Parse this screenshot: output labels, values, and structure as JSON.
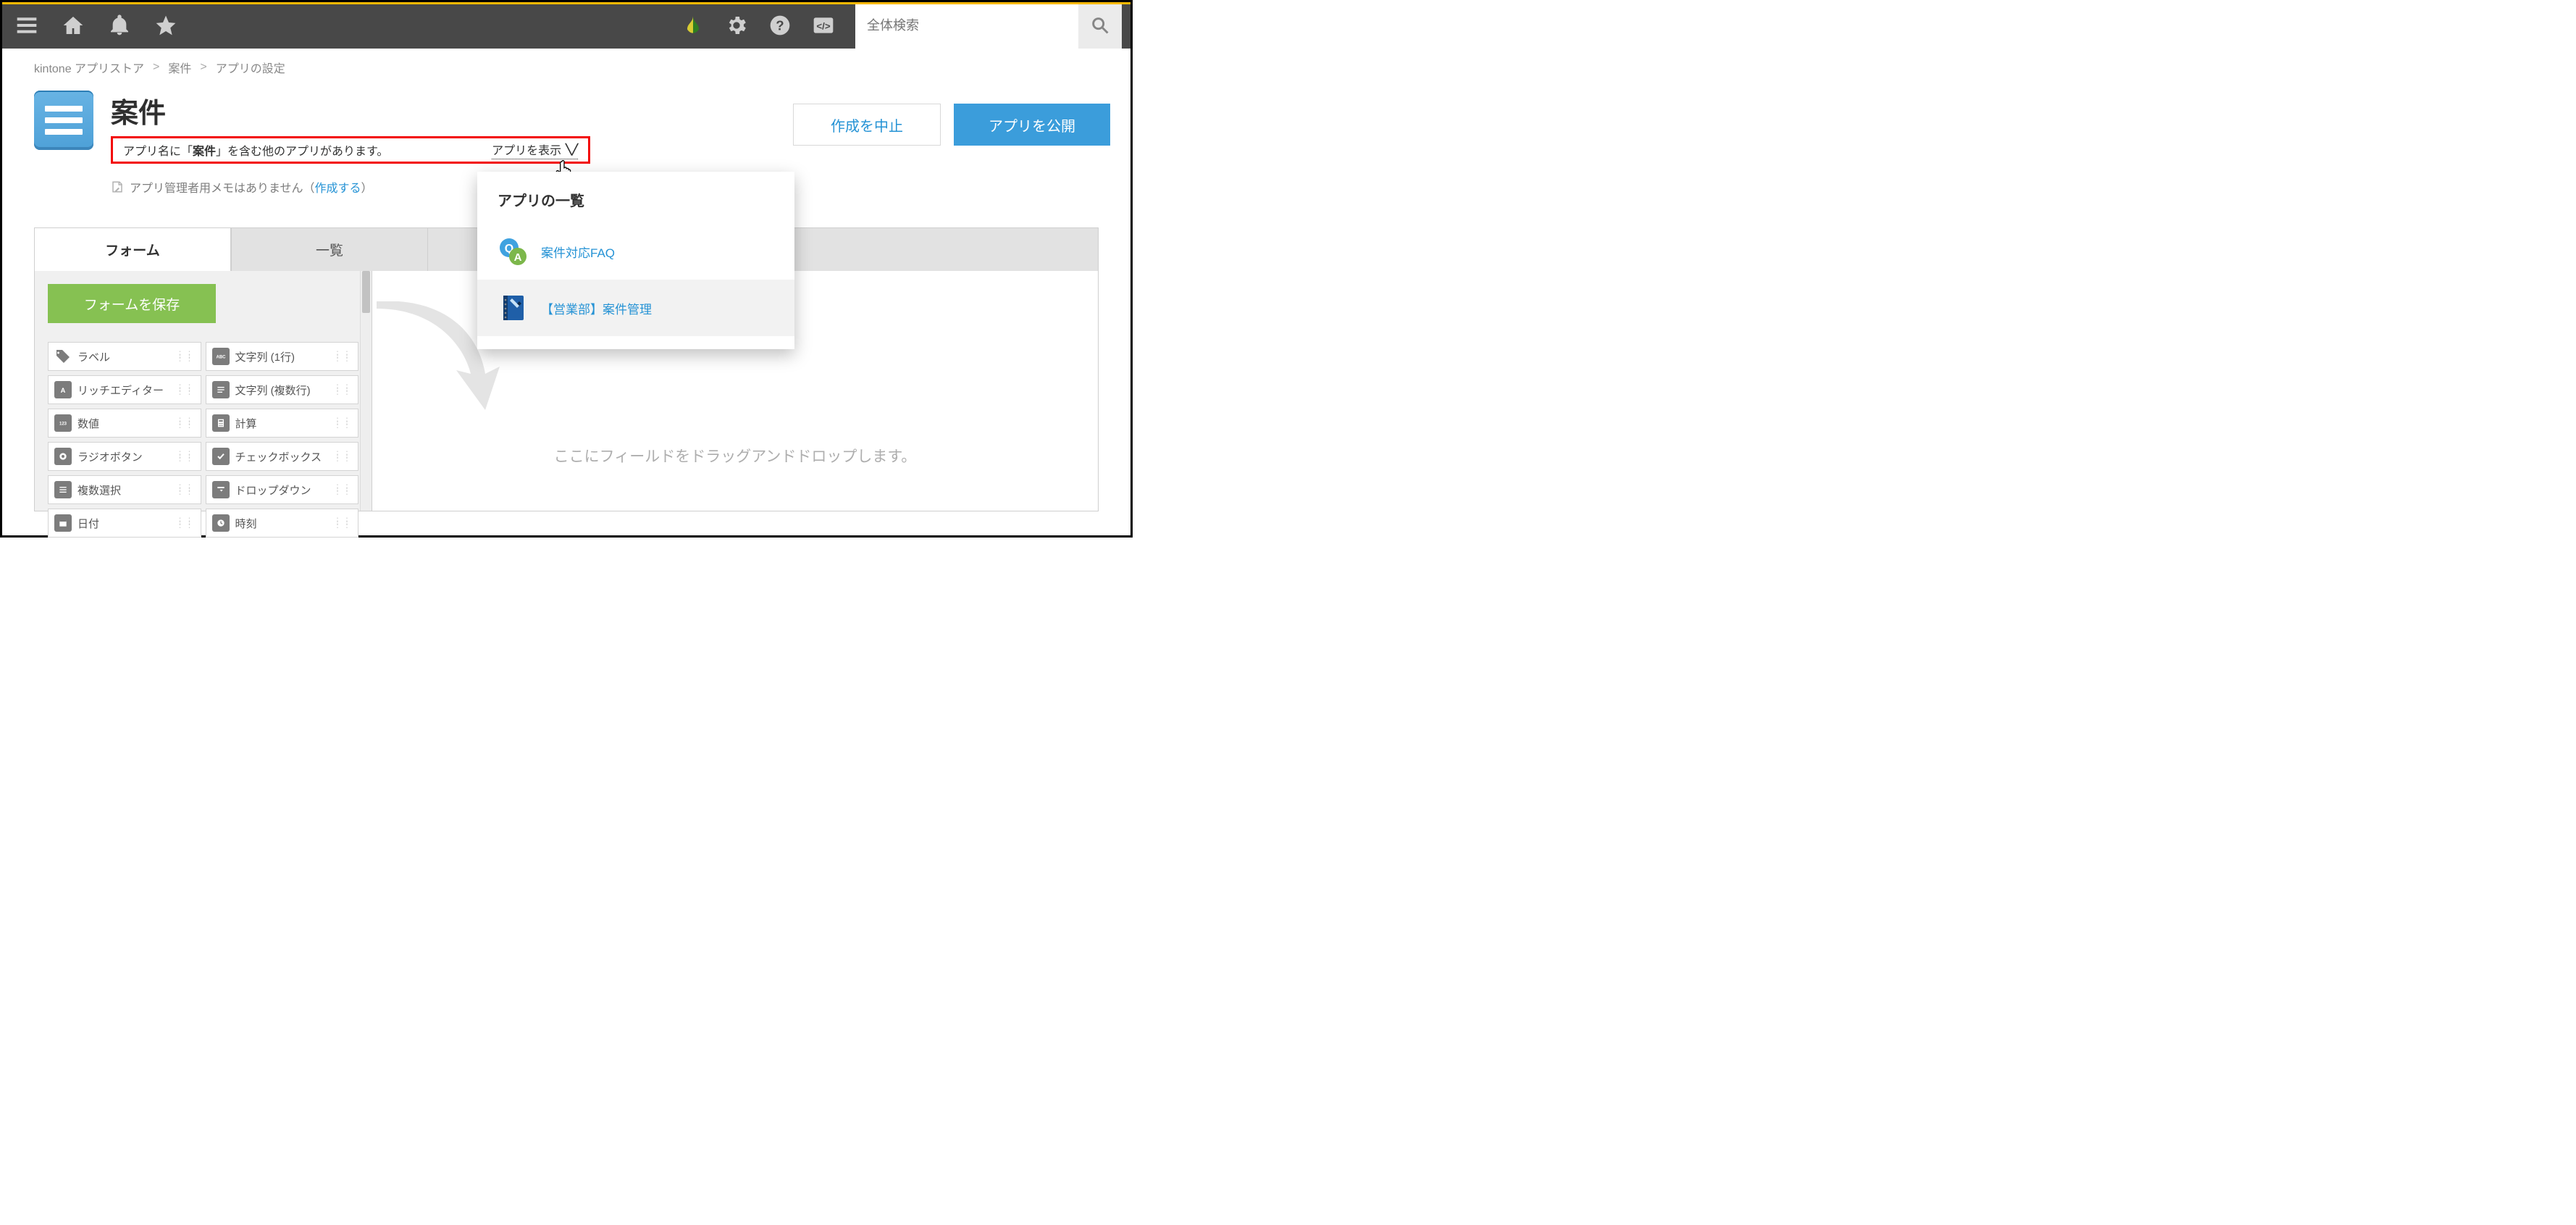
{
  "search": {
    "placeholder": "全体検索"
  },
  "breadcrumb": {
    "items": [
      "kintone アプリストア",
      "案件",
      "アプリの設定"
    ]
  },
  "app": {
    "title": "案件"
  },
  "notice": {
    "text_prefix": "アプリ名に「",
    "text_bold": "案件",
    "text_suffix": "」を含む他のアプリがあります。",
    "toggle_label": "アプリを表示"
  },
  "memo": {
    "text": "アプリ管理者用メモはありません（",
    "link": "作成する",
    "text_after": "）"
  },
  "actions": {
    "cancel": "作成を中止",
    "publish": "アプリを公開"
  },
  "tabs": {
    "form": "フォーム",
    "list": "一覧"
  },
  "panel": {
    "save": "フォームを保存",
    "fields": [
      "ラベル",
      "文字列 (1行)",
      "リッチエディター",
      "文字列 (複数行)",
      "数値",
      "計算",
      "ラジオボタン",
      "チェックボックス",
      "複数選択",
      "ドロップダウン",
      "日付",
      "時刻"
    ]
  },
  "canvas": {
    "hint": "ここにフィールドをドラッグアンドドロップします。"
  },
  "popover": {
    "title": "アプリの一覧",
    "items": [
      {
        "label": "案件対応FAQ"
      },
      {
        "label": "【営業部】案件管理"
      }
    ]
  }
}
